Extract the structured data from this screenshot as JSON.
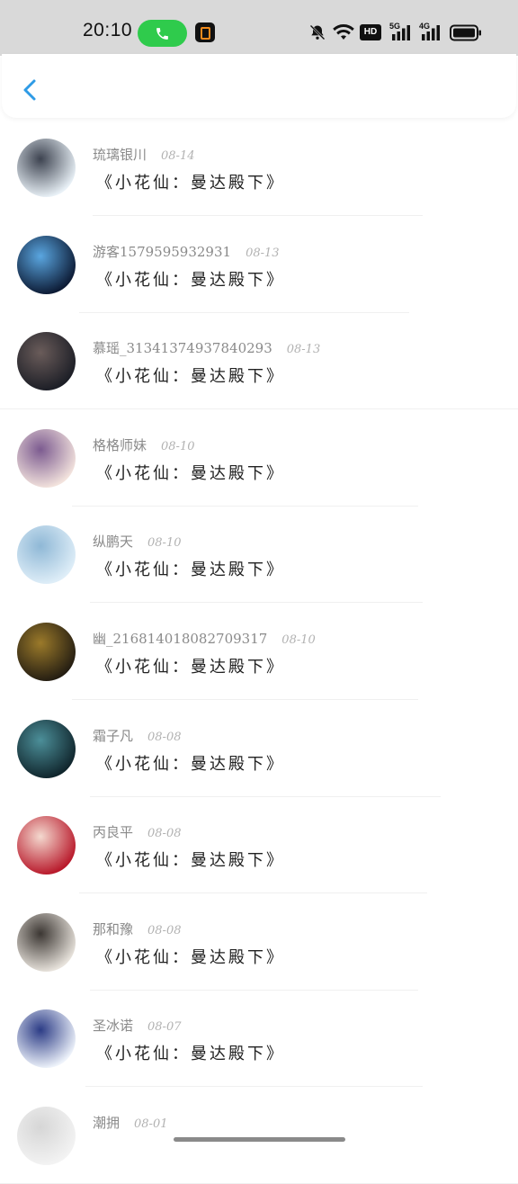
{
  "status_bar": {
    "time": "20:10",
    "hd_label": "HD",
    "signal_1_label": "5G",
    "signal_2_label": "4G",
    "colors": {
      "call_pill": "#2fcb4c",
      "app_badge_accent": "#f08a1c"
    },
    "icons": [
      "phone-icon",
      "app-notification-icon",
      "mute-bell-icon",
      "wifi-icon",
      "hd-icon",
      "signal-5g-icon",
      "signal-4g-icon",
      "battery-icon"
    ]
  },
  "header": {
    "back_icon": "chevron-left-icon",
    "accent": "#2e9be6"
  },
  "items": [
    {
      "name": "琉璃银川",
      "date": "08-14",
      "message": "《小花仙：曼达殿下》",
      "avatar_colors": [
        "#e9f1f7",
        "#3d4350"
      ]
    },
    {
      "name": "游客1579595932931",
      "date": "08-13",
      "message": "《小花仙：曼达殿下》",
      "avatar_colors": [
        "#0c1a34",
        "#5aa6e0"
      ]
    },
    {
      "name": "慕瑶_31341374937840293",
      "date": "08-13",
      "message": "《小花仙：曼达殿下》",
      "avatar_colors": [
        "#1c1e26",
        "#6a5c5a"
      ]
    },
    {
      "name": "格格师妹",
      "date": "08-10",
      "message": "《小花仙：曼达殿下》",
      "avatar_colors": [
        "#f3e3dd",
        "#7c5b90"
      ]
    },
    {
      "name": "纵鹏天",
      "date": "08-10",
      "message": "《小花仙：曼达殿下》",
      "avatar_colors": [
        "#dfeef8",
        "#8fb8d6"
      ]
    },
    {
      "name": "幽_216814018082709317",
      "date": "08-10",
      "message": "《小花仙：曼达殿下》",
      "avatar_colors": [
        "#241d12",
        "#9b7a2a"
      ]
    },
    {
      "name": "霜子凡",
      "date": "08-08",
      "message": "《小花仙：曼达殿下》",
      "avatar_colors": [
        "#10252c",
        "#4c8f99"
      ]
    },
    {
      "name": "丙良平",
      "date": "08-08",
      "message": "《小花仙：曼达殿下》",
      "avatar_colors": [
        "#b8182a",
        "#f4d9cf"
      ]
    },
    {
      "name": "那和豫",
      "date": "08-08",
      "message": "《小花仙：曼达殿下》",
      "avatar_colors": [
        "#e8e3dc",
        "#3c3733"
      ]
    },
    {
      "name": "圣冰诺",
      "date": "08-07",
      "message": "《小花仙：曼达殿下》",
      "avatar_colors": [
        "#eef3fb",
        "#2c3c86"
      ]
    },
    {
      "name": "潮拥",
      "date": "08-01",
      "message": "",
      "avatar_colors": [
        "#f3f3f3",
        "#d6d6d6"
      ]
    }
  ]
}
